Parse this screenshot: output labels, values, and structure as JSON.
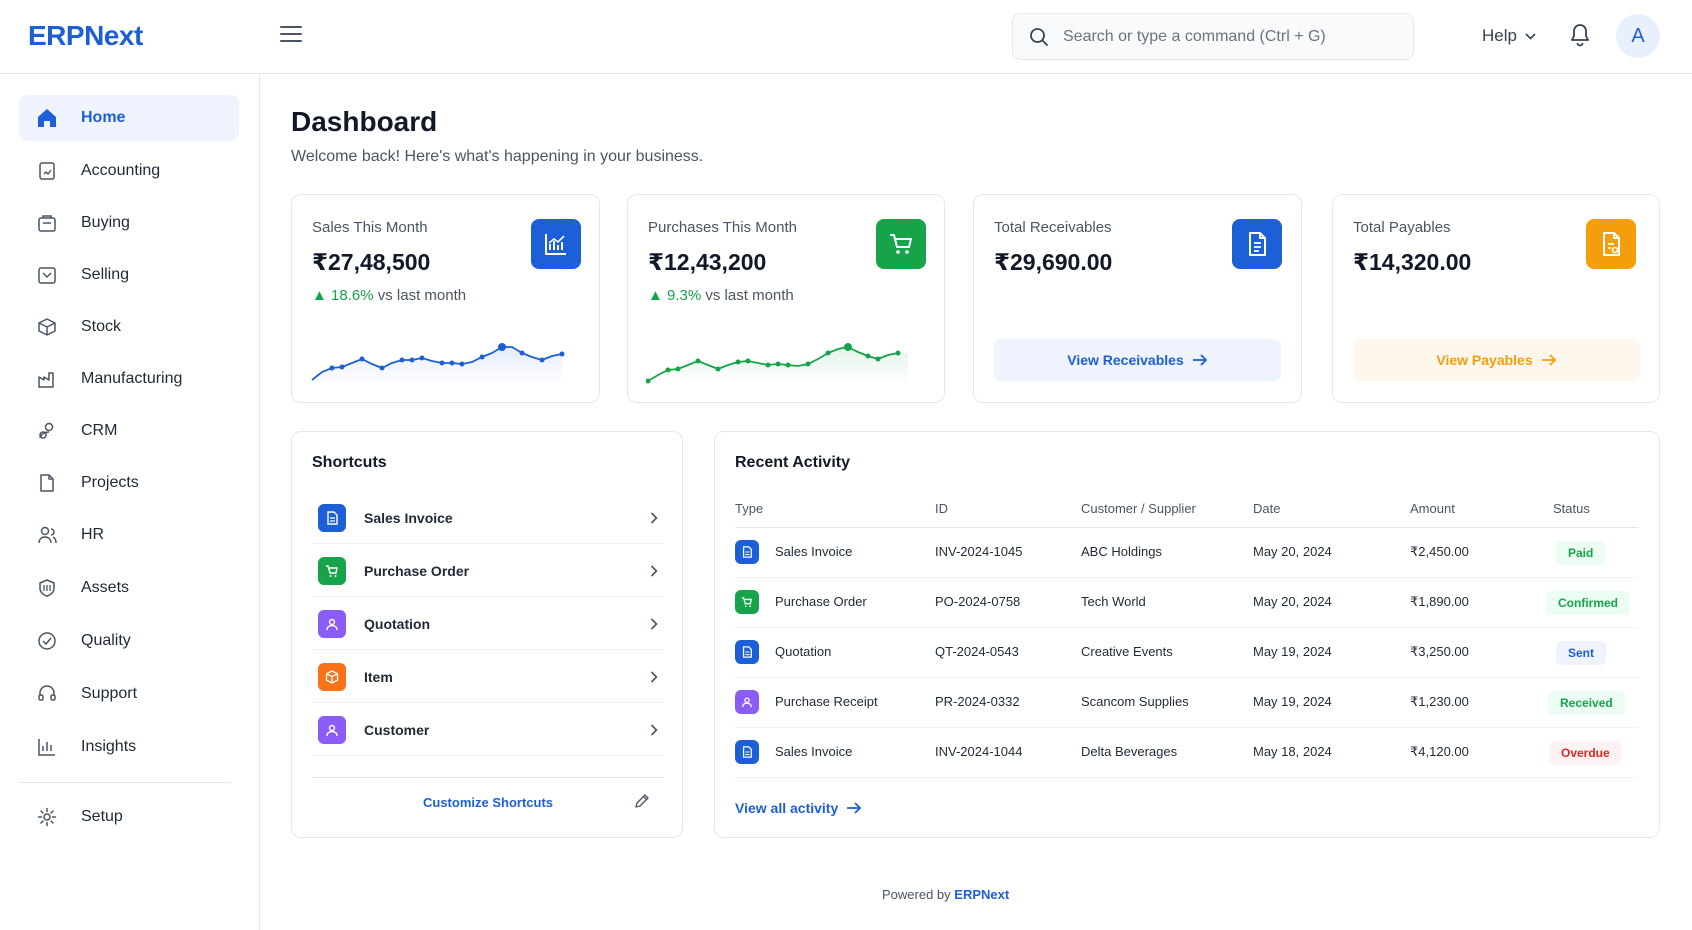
{
  "header": {
    "logo": "ERPNext",
    "search_placeholder": "Search or type a command (Ctrl + G)",
    "help_label": "Help",
    "avatar_initial": "A"
  },
  "sidebar": {
    "items": [
      {
        "label": "Home",
        "icon": "home-icon",
        "active": true
      },
      {
        "label": "Accounting",
        "icon": "accounting-icon"
      },
      {
        "label": "Buying",
        "icon": "buying-icon"
      },
      {
        "label": "Selling",
        "icon": "selling-icon"
      },
      {
        "label": "Stock",
        "icon": "stock-icon"
      },
      {
        "label": "Manufacturing",
        "icon": "manufacturing-icon"
      },
      {
        "label": "CRM",
        "icon": "crm-icon"
      },
      {
        "label": "Projects",
        "icon": "projects-icon"
      },
      {
        "label": "HR",
        "icon": "hr-icon"
      },
      {
        "label": "Assets",
        "icon": "assets-icon"
      },
      {
        "label": "Quality",
        "icon": "quality-icon"
      },
      {
        "label": "Support",
        "icon": "support-icon"
      },
      {
        "label": "Insights",
        "icon": "insights-icon"
      }
    ],
    "setup_label": "Setup"
  },
  "page": {
    "title": "Dashboard",
    "subtitle": "Welcome back! Here's what's happening in your business."
  },
  "stats": {
    "sales": {
      "label": "Sales This Month",
      "value": "₹27,48,500",
      "trend_pct": "18.6%",
      "trend_text": "vs last month",
      "color": "#1d5fd6",
      "icon": "chart-icon"
    },
    "purchases": {
      "label": "Purchases This Month",
      "value": "₹12,43,200",
      "trend_pct": "9.3%",
      "trend_text": "vs last month",
      "color": "#16a34a",
      "icon": "cart-icon"
    },
    "receivables": {
      "label": "Total Receivables",
      "value": "₹29,690.00",
      "button": "View Receivables",
      "color": "#1d5fd6",
      "icon": "document-icon"
    },
    "payables": {
      "label": "Total Payables",
      "value": "₹14,320.00",
      "button": "View Payables",
      "color": "#f59e0b",
      "icon": "invoice-icon"
    }
  },
  "shortcuts": {
    "title": "Shortcuts",
    "items": [
      {
        "label": "Sales Invoice",
        "icon": "document-icon",
        "color": "#1d5fd6"
      },
      {
        "label": "Purchase Order",
        "icon": "cart-icon",
        "color": "#16a34a"
      },
      {
        "label": "Quotation",
        "icon": "user-icon",
        "color": "#8b5cf6"
      },
      {
        "label": "Item",
        "icon": "box-icon",
        "color": "#f97316"
      },
      {
        "label": "Customer",
        "icon": "user-icon",
        "color": "#8b5cf6"
      }
    ],
    "customize_label": "Customize Shortcuts"
  },
  "activity": {
    "title": "Recent Activity",
    "columns": [
      "Type",
      "ID",
      "Customer / Supplier",
      "Date",
      "Amount",
      "Status"
    ],
    "rows": [
      {
        "type": "Sales Invoice",
        "id": "INV-2024-1045",
        "party": "ABC Holdings",
        "date": "May 20, 2024",
        "amount": "₹2,450.00",
        "status": "Paid",
        "icon": "document-icon",
        "icon_color": "#1d5fd6",
        "status_color": "#16a34a",
        "status_bg": "#ecfdf3"
      },
      {
        "type": "Purchase Order",
        "id": "PO-2024-0758",
        "party": "Tech World",
        "date": "May 20, 2024",
        "amount": "₹1,890.00",
        "status": "Confirmed",
        "icon": "cart-icon",
        "icon_color": "#16a34a",
        "status_color": "#16a34a",
        "status_bg": "#ecfdf3"
      },
      {
        "type": "Quotation",
        "id": "QT-2024-0543",
        "party": "Creative Events",
        "date": "May 19, 2024",
        "amount": "₹3,250.00",
        "status": "Sent",
        "icon": "document-icon",
        "icon_color": "#1d5fd6",
        "status_color": "#1d5fd6",
        "status_bg": "#eef3fd"
      },
      {
        "type": "Purchase Receipt",
        "id": "PR-2024-0332",
        "party": "Scancom Supplies",
        "date": "May 19, 2024",
        "amount": "₹1,230.00",
        "status": "Received",
        "icon": "user-icon",
        "icon_color": "#8b5cf6",
        "status_color": "#16a34a",
        "status_bg": "#ecfdf3"
      },
      {
        "type": "Sales Invoice",
        "id": "INV-2024-1044",
        "party": "Delta Beverages",
        "date": "May 18, 2024",
        "amount": "₹4,120.00",
        "status": "Overdue",
        "icon": "document-icon",
        "icon_color": "#1d5fd6",
        "status_color": "#dc2626",
        "status_bg": "#fef2f2"
      }
    ],
    "view_all_label": "View all activity"
  },
  "footer": {
    "prefix": "Powered by",
    "brand": "ERPNext"
  }
}
